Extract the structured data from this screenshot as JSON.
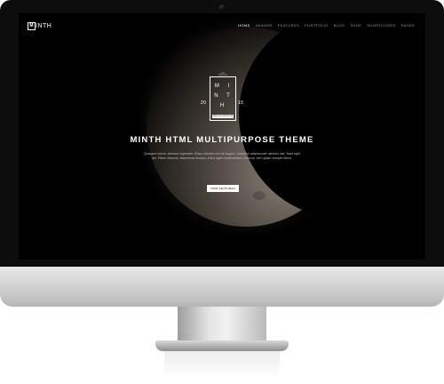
{
  "brand": {
    "logo_letter": "M",
    "name": "INTH"
  },
  "nav": {
    "items": [
      "HOME",
      "HEADER",
      "FEATURES",
      "PORTFOLIO",
      "BLOG",
      "SHOP",
      "SHORTCODES",
      "PAGES"
    ]
  },
  "hero": {
    "badge_top": "HTML TEMPLATE",
    "badge_letters": "M I N T H",
    "badge_bottom": "MINTH MULTIPURPOSE",
    "year_left": "20",
    "year_right": "15",
    "title": "MINTH HTML MULTIPURPOSE THEME",
    "subtitle": "Quisque rutrum. Aenean imperdiet. Etiam ultricies nisi vel augue. Curabitur ullamcorper ultricies nisi. Nam eget dui. Etiam rhoncus. Maecenas tempus, tellus eget condimentum rhoncus, sem quam semper libero.",
    "button_label": "VIEW FEATURES"
  }
}
